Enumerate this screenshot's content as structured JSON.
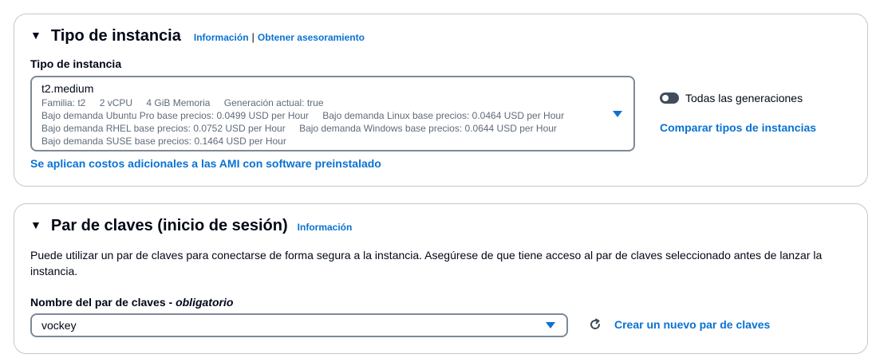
{
  "instance_type": {
    "caret": "▼",
    "title": "Tipo de instancia",
    "info_link": "Información",
    "separator": "|",
    "advice_link": "Obtener asesoramiento",
    "field_label": "Tipo de instancia",
    "selected": {
      "name": "t2.medium",
      "family": "Familia: t2",
      "vcpu": "2 vCPU",
      "memory": "4 GiB Memoria",
      "current_gen": "Generación actual: true",
      "ubuntu_price": "Bajo demanda Ubuntu Pro base precios: 0.0499 USD per Hour",
      "linux_price": "Bajo demanda Linux base precios: 0.0464 USD per Hour",
      "rhel_price": "Bajo demanda RHEL base precios: 0.0752 USD per Hour",
      "windows_price": "Bajo demanda Windows base precios: 0.0644 USD per Hour",
      "suse_price": "Bajo demanda SUSE base precios: 0.1464 USD per Hour"
    },
    "all_generations_label": "Todas las generaciones",
    "all_generations_on": false,
    "compare_link": "Comparar tipos de instancias",
    "ami_costs_link": "Se aplican costos adicionales a las AMI con software preinstalado"
  },
  "key_pair": {
    "caret": "▼",
    "title": "Par de claves (inicio de sesión)",
    "info_link": "Información",
    "description": "Puede utilizar un par de claves para conectarse de forma segura a la instancia. Asegúrese de que tiene acceso al par de claves seleccionado antes de lanzar la instancia.",
    "field_label": "Nombre del par de claves - ",
    "field_required": "obligatorio",
    "selected": "vockey",
    "create_link": "Crear un nuevo par de claves"
  },
  "colors": {
    "link": "#0972d3",
    "border": "#c6c6cd",
    "text": "#000716",
    "secondary": "#5f6b7a"
  },
  "icons": [
    "caret-down-icon",
    "dropdown-arrow-icon",
    "toggle-switch-icon",
    "refresh-icon"
  ]
}
